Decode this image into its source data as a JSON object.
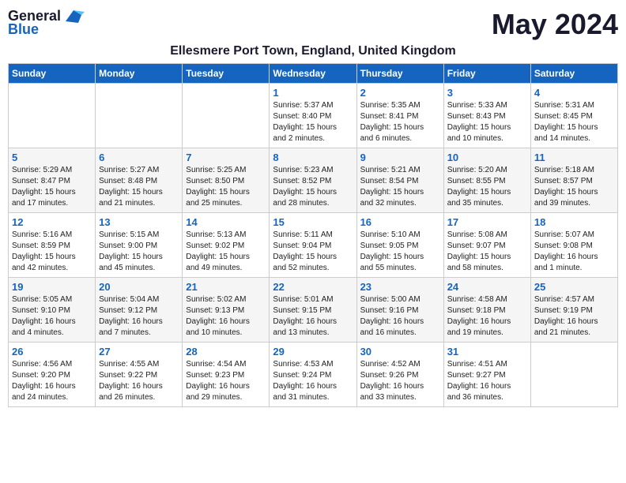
{
  "logo": {
    "general": "General",
    "blue": "Blue"
  },
  "month_title": "May 2024",
  "location": "Ellesmere Port Town, England, United Kingdom",
  "days_of_week": [
    "Sunday",
    "Monday",
    "Tuesday",
    "Wednesday",
    "Thursday",
    "Friday",
    "Saturday"
  ],
  "weeks": [
    {
      "days": [
        {
          "num": "",
          "info": ""
        },
        {
          "num": "",
          "info": ""
        },
        {
          "num": "",
          "info": ""
        },
        {
          "num": "1",
          "info": "Sunrise: 5:37 AM\nSunset: 8:40 PM\nDaylight: 15 hours\nand 2 minutes."
        },
        {
          "num": "2",
          "info": "Sunrise: 5:35 AM\nSunset: 8:41 PM\nDaylight: 15 hours\nand 6 minutes."
        },
        {
          "num": "3",
          "info": "Sunrise: 5:33 AM\nSunset: 8:43 PM\nDaylight: 15 hours\nand 10 minutes."
        },
        {
          "num": "4",
          "info": "Sunrise: 5:31 AM\nSunset: 8:45 PM\nDaylight: 15 hours\nand 14 minutes."
        }
      ]
    },
    {
      "days": [
        {
          "num": "5",
          "info": "Sunrise: 5:29 AM\nSunset: 8:47 PM\nDaylight: 15 hours\nand 17 minutes."
        },
        {
          "num": "6",
          "info": "Sunrise: 5:27 AM\nSunset: 8:48 PM\nDaylight: 15 hours\nand 21 minutes."
        },
        {
          "num": "7",
          "info": "Sunrise: 5:25 AM\nSunset: 8:50 PM\nDaylight: 15 hours\nand 25 minutes."
        },
        {
          "num": "8",
          "info": "Sunrise: 5:23 AM\nSunset: 8:52 PM\nDaylight: 15 hours\nand 28 minutes."
        },
        {
          "num": "9",
          "info": "Sunrise: 5:21 AM\nSunset: 8:54 PM\nDaylight: 15 hours\nand 32 minutes."
        },
        {
          "num": "10",
          "info": "Sunrise: 5:20 AM\nSunset: 8:55 PM\nDaylight: 15 hours\nand 35 minutes."
        },
        {
          "num": "11",
          "info": "Sunrise: 5:18 AM\nSunset: 8:57 PM\nDaylight: 15 hours\nand 39 minutes."
        }
      ]
    },
    {
      "days": [
        {
          "num": "12",
          "info": "Sunrise: 5:16 AM\nSunset: 8:59 PM\nDaylight: 15 hours\nand 42 minutes."
        },
        {
          "num": "13",
          "info": "Sunrise: 5:15 AM\nSunset: 9:00 PM\nDaylight: 15 hours\nand 45 minutes."
        },
        {
          "num": "14",
          "info": "Sunrise: 5:13 AM\nSunset: 9:02 PM\nDaylight: 15 hours\nand 49 minutes."
        },
        {
          "num": "15",
          "info": "Sunrise: 5:11 AM\nSunset: 9:04 PM\nDaylight: 15 hours\nand 52 minutes."
        },
        {
          "num": "16",
          "info": "Sunrise: 5:10 AM\nSunset: 9:05 PM\nDaylight: 15 hours\nand 55 minutes."
        },
        {
          "num": "17",
          "info": "Sunrise: 5:08 AM\nSunset: 9:07 PM\nDaylight: 15 hours\nand 58 minutes."
        },
        {
          "num": "18",
          "info": "Sunrise: 5:07 AM\nSunset: 9:08 PM\nDaylight: 16 hours\nand 1 minute."
        }
      ]
    },
    {
      "days": [
        {
          "num": "19",
          "info": "Sunrise: 5:05 AM\nSunset: 9:10 PM\nDaylight: 16 hours\nand 4 minutes."
        },
        {
          "num": "20",
          "info": "Sunrise: 5:04 AM\nSunset: 9:12 PM\nDaylight: 16 hours\nand 7 minutes."
        },
        {
          "num": "21",
          "info": "Sunrise: 5:02 AM\nSunset: 9:13 PM\nDaylight: 16 hours\nand 10 minutes."
        },
        {
          "num": "22",
          "info": "Sunrise: 5:01 AM\nSunset: 9:15 PM\nDaylight: 16 hours\nand 13 minutes."
        },
        {
          "num": "23",
          "info": "Sunrise: 5:00 AM\nSunset: 9:16 PM\nDaylight: 16 hours\nand 16 minutes."
        },
        {
          "num": "24",
          "info": "Sunrise: 4:58 AM\nSunset: 9:18 PM\nDaylight: 16 hours\nand 19 minutes."
        },
        {
          "num": "25",
          "info": "Sunrise: 4:57 AM\nSunset: 9:19 PM\nDaylight: 16 hours\nand 21 minutes."
        }
      ]
    },
    {
      "days": [
        {
          "num": "26",
          "info": "Sunrise: 4:56 AM\nSunset: 9:20 PM\nDaylight: 16 hours\nand 24 minutes."
        },
        {
          "num": "27",
          "info": "Sunrise: 4:55 AM\nSunset: 9:22 PM\nDaylight: 16 hours\nand 26 minutes."
        },
        {
          "num": "28",
          "info": "Sunrise: 4:54 AM\nSunset: 9:23 PM\nDaylight: 16 hours\nand 29 minutes."
        },
        {
          "num": "29",
          "info": "Sunrise: 4:53 AM\nSunset: 9:24 PM\nDaylight: 16 hours\nand 31 minutes."
        },
        {
          "num": "30",
          "info": "Sunrise: 4:52 AM\nSunset: 9:26 PM\nDaylight: 16 hours\nand 33 minutes."
        },
        {
          "num": "31",
          "info": "Sunrise: 4:51 AM\nSunset: 9:27 PM\nDaylight: 16 hours\nand 36 minutes."
        },
        {
          "num": "",
          "info": ""
        }
      ]
    }
  ]
}
